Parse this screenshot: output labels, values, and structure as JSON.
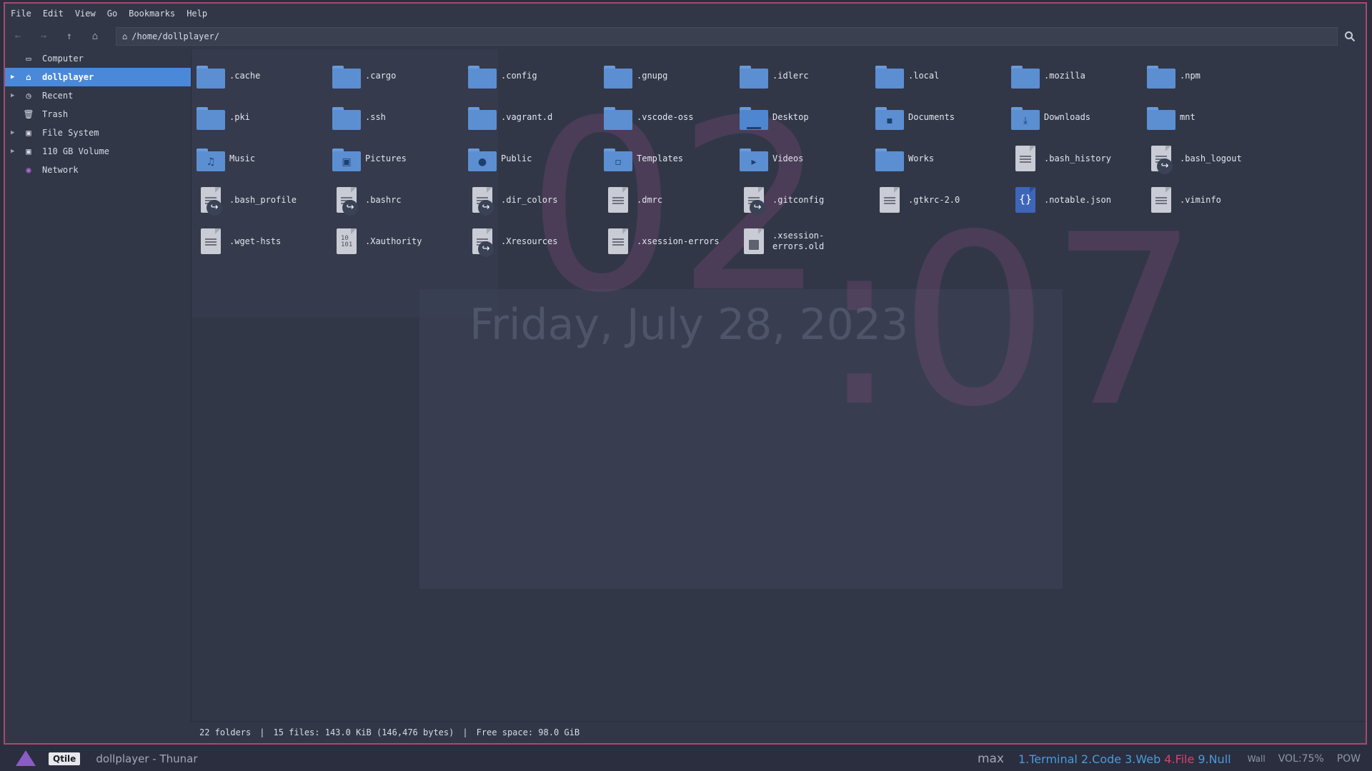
{
  "menu": [
    "File",
    "Edit",
    "View",
    "Go",
    "Bookmarks",
    "Help"
  ],
  "location": {
    "path": "/home/dollplayer/"
  },
  "sidebar": {
    "items": [
      {
        "label": "Computer",
        "icon": "computer-icon",
        "expandable": false
      },
      {
        "label": "dollplayer",
        "icon": "home-icon",
        "expandable": true,
        "active": true
      },
      {
        "label": "Recent",
        "icon": "clock-icon",
        "expandable": true
      },
      {
        "label": "Trash",
        "icon": "trash-icon",
        "expandable": false
      },
      {
        "label": "File System",
        "icon": "drive-icon",
        "expandable": true
      },
      {
        "label": "110 GB Volume",
        "icon": "drive-icon",
        "expandable": true
      },
      {
        "label": "Network",
        "icon": "network-icon",
        "expandable": false
      }
    ]
  },
  "files": [
    {
      "name": ".cache",
      "kind": "folder"
    },
    {
      "name": ".cargo",
      "kind": "folder"
    },
    {
      "name": ".config",
      "kind": "folder"
    },
    {
      "name": ".gnupg",
      "kind": "folder"
    },
    {
      "name": ".idlerc",
      "kind": "folder"
    },
    {
      "name": ".local",
      "kind": "folder"
    },
    {
      "name": ".mozilla",
      "kind": "folder"
    },
    {
      "name": ".npm",
      "kind": "folder"
    },
    {
      "name": ".pki",
      "kind": "folder"
    },
    {
      "name": ".ssh",
      "kind": "folder"
    },
    {
      "name": ".vagrant.d",
      "kind": "folder"
    },
    {
      "name": ".vscode-oss",
      "kind": "folder"
    },
    {
      "name": "Desktop",
      "kind": "desktop"
    },
    {
      "name": "Documents",
      "kind": "folder",
      "glyph": "▪"
    },
    {
      "name": "Downloads",
      "kind": "folder",
      "glyph": "⤓"
    },
    {
      "name": "mnt",
      "kind": "folder"
    },
    {
      "name": "Music",
      "kind": "folder",
      "glyph": "♫"
    },
    {
      "name": "Pictures",
      "kind": "folder",
      "glyph": "▣"
    },
    {
      "name": "Public",
      "kind": "folder",
      "glyph": "●"
    },
    {
      "name": "Templates",
      "kind": "folder",
      "glyph": "▫"
    },
    {
      "name": "Videos",
      "kind": "folder",
      "glyph": "▸"
    },
    {
      "name": "Works",
      "kind": "folder"
    },
    {
      "name": ".bash_history",
      "kind": "text"
    },
    {
      "name": ".bash_logout",
      "kind": "link"
    },
    {
      "name": ".bash_profile",
      "kind": "link"
    },
    {
      "name": ".bashrc",
      "kind": "link"
    },
    {
      "name": ".dir_colors",
      "kind": "link"
    },
    {
      "name": ".dmrc",
      "kind": "text"
    },
    {
      "name": ".gitconfig",
      "kind": "link"
    },
    {
      "name": ".gtkrc-2.0",
      "kind": "text"
    },
    {
      "name": ".notable.json",
      "kind": "json"
    },
    {
      "name": ".viminfo",
      "kind": "text"
    },
    {
      "name": ".wget-hsts",
      "kind": "text"
    },
    {
      "name": ".Xauthority",
      "kind": "binary"
    },
    {
      "name": ".Xresources",
      "kind": "link"
    },
    {
      "name": ".xsession-errors",
      "kind": "text"
    },
    {
      "name": ".xsession-errors.old",
      "kind": "trash"
    }
  ],
  "status": {
    "folders": "22 folders",
    "files": "15 files: 143.0 KiB (146,476 bytes)",
    "free": "Free space: 98.0 GiB"
  },
  "qtile": {
    "tag": "Qtile",
    "window_title": "dollplayer - Thunar",
    "layout": "max",
    "groups": [
      {
        "label": "1.Terminal",
        "color": "#4a9bd9"
      },
      {
        "label": "2.Code",
        "color": "#4a9bd9"
      },
      {
        "label": "3.Web",
        "color": "#4a9bd9"
      },
      {
        "label": "4.File",
        "color": "#d8426f"
      },
      {
        "label": "9.Null",
        "color": "#4a9bd9"
      }
    ],
    "wall": "Wall",
    "vol": "VOL:75%",
    "pow": "POW"
  },
  "colors": {
    "accent": "#4a89d9",
    "window_border": "#a8496c",
    "background": "#323747"
  }
}
